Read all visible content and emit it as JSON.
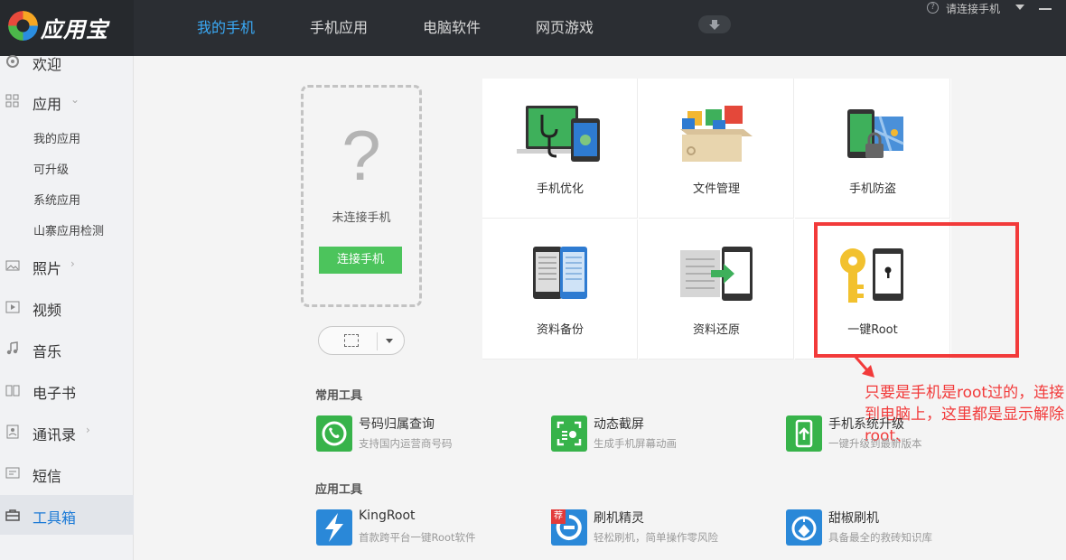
{
  "app": {
    "name": "应用宝"
  },
  "nav": [
    {
      "label": "我的手机",
      "active": true
    },
    {
      "label": "手机应用"
    },
    {
      "label": "电脑软件"
    },
    {
      "label": "网页游戏"
    }
  ],
  "topbar": {
    "connect_text": "请连接手机"
  },
  "sidebar": {
    "items": [
      {
        "label": "欢迎",
        "icon": "welcome-icon"
      },
      {
        "label": "应用",
        "icon": "grid-icon"
      },
      {
        "label": "照片",
        "icon": "photo-icon"
      },
      {
        "label": "视频",
        "icon": "video-icon"
      },
      {
        "label": "音乐",
        "icon": "music-icon"
      },
      {
        "label": "电子书",
        "icon": "book-icon"
      },
      {
        "label": "通讯录",
        "icon": "contacts-icon"
      },
      {
        "label": "短信",
        "icon": "sms-icon"
      },
      {
        "label": "工具箱",
        "icon": "toolbox-icon",
        "active": true
      }
    ],
    "app_sub": [
      "我的应用",
      "可升级",
      "系统应用",
      "山寨应用检测"
    ]
  },
  "phone_panel": {
    "question_mark": "?",
    "status": "未连接手机",
    "connect_button": "连接手机"
  },
  "grid": [
    {
      "label": "手机优化",
      "icon": "phone-optimize-icon"
    },
    {
      "label": "文件管理",
      "icon": "file-manage-icon"
    },
    {
      "label": "手机防盗",
      "icon": "anti-theft-icon"
    },
    {
      "label": "资料备份",
      "icon": "backup-icon"
    },
    {
      "label": "资料还原",
      "icon": "restore-icon"
    },
    {
      "label": "一键Root",
      "icon": "root-key-icon"
    }
  ],
  "annotation": "只要是手机是root过的，连接到电脑上，这里都是显示解除root、",
  "sections": {
    "common_tools": "常用工具",
    "app_tools": "应用工具"
  },
  "common_tools": [
    {
      "name": "号码归属查询",
      "desc": "支持国内运营商号码",
      "icon": "phone-lookup-icon",
      "color": "#37b34a"
    },
    {
      "name": "动态截屏",
      "desc": "生成手机屏幕动画",
      "icon": "screen-capture-icon",
      "color": "#37b34a"
    },
    {
      "name": "手机系统升级",
      "desc": "一键升级到最新版本",
      "icon": "system-upgrade-icon",
      "color": "#37b34a"
    }
  ],
  "app_tools": [
    {
      "name": "KingRoot",
      "desc": "首款跨平台一键Root软件",
      "icon": "kingroot-icon",
      "color": "#2a88d8"
    },
    {
      "name": "刷机精灵",
      "desc": "轻松刷机，简单操作零风险",
      "icon": "flash-wizard-icon",
      "color": "#2a88d8",
      "badge": "荐"
    },
    {
      "name": "甜椒刷机",
      "desc": "具备最全的救砖知识库",
      "icon": "tianjiao-icon",
      "color": "#2a88d8"
    }
  ]
}
